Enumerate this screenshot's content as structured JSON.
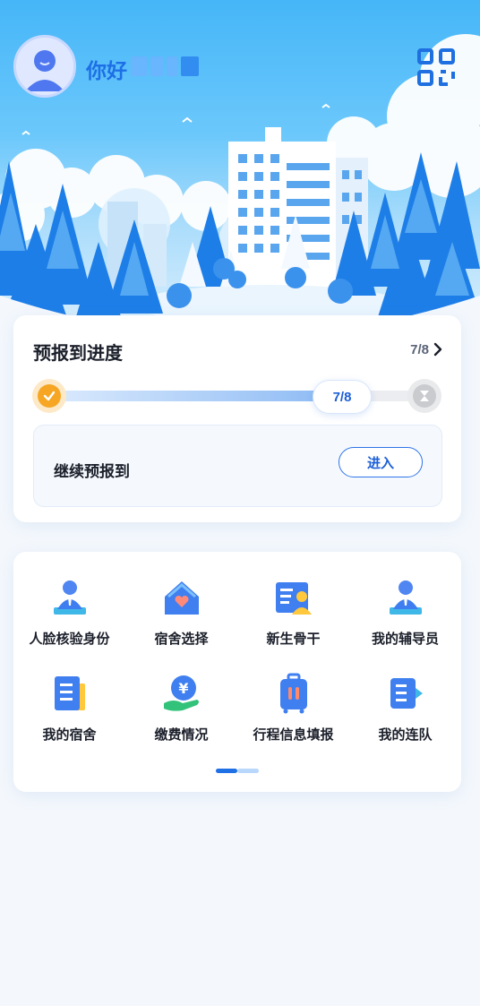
{
  "header": {
    "greeting": "你好",
    "icons": {
      "avatar": "user-avatar-icon",
      "scan": "qr-scan-icon"
    }
  },
  "progress": {
    "title": "预报到进度",
    "count": "7/8",
    "current": 7,
    "total": 8,
    "pill": "7/8",
    "continue_label": "继续预报到",
    "enter_label": "进入"
  },
  "menu": {
    "items": [
      {
        "label": "人脸核验身份",
        "icon": "face-verify-icon"
      },
      {
        "label": "宿舍选择",
        "icon": "house-heart-icon"
      },
      {
        "label": "新生骨干",
        "icon": "id-card-icon"
      },
      {
        "label": "我的辅导员",
        "icon": "counselor-icon"
      },
      {
        "label": "我的宿舍",
        "icon": "dorm-document-icon"
      },
      {
        "label": "缴费情况",
        "icon": "payment-yuan-icon"
      },
      {
        "label": "行程信息填报",
        "icon": "luggage-icon"
      },
      {
        "label": "我的连队",
        "icon": "company-document-icon"
      }
    ],
    "pager": {
      "pages": 2,
      "active": 1
    }
  },
  "colors": {
    "accent": "#1f6fe5",
    "brand_orange": "#f6a623"
  }
}
